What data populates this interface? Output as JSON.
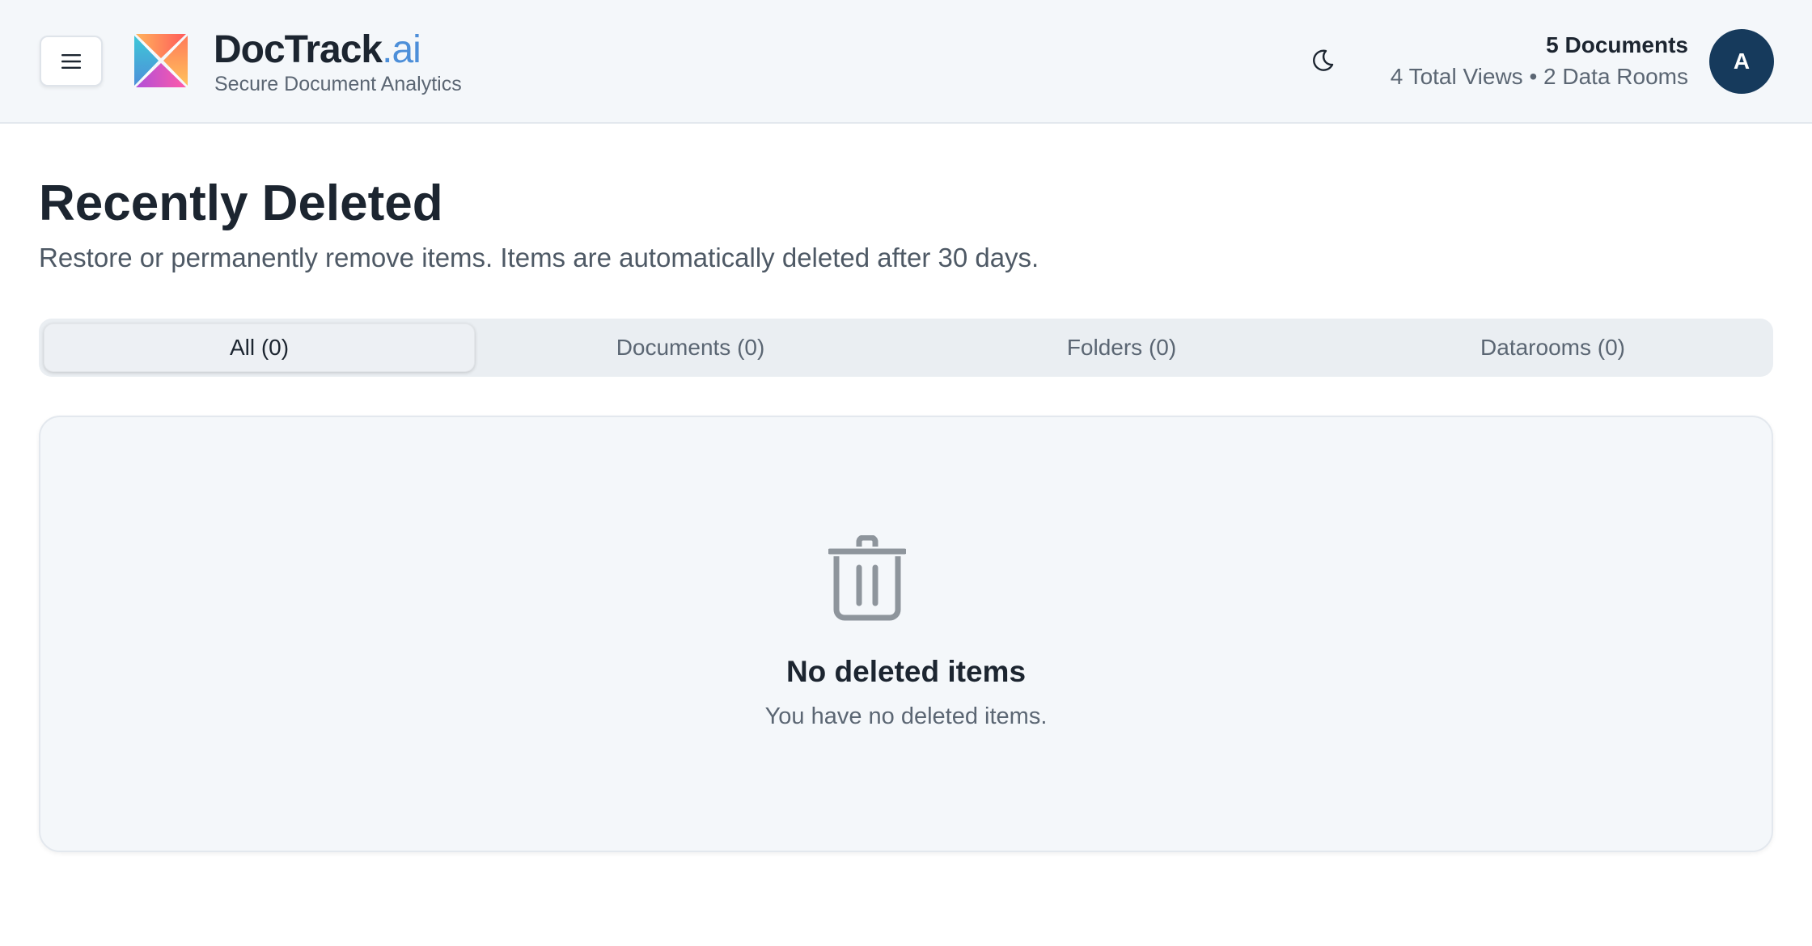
{
  "header": {
    "brand_name": "DocTrack",
    "brand_suffix": ".ai",
    "brand_tagline": "Secure Document Analytics",
    "stats_documents": "5 Documents",
    "stats_detail": "4 Total Views • 2 Data Rooms",
    "avatar_initial": "A",
    "icons": [
      "hamburger-menu-icon",
      "logo",
      "moon-icon"
    ]
  },
  "page": {
    "title": "Recently Deleted",
    "description": "Restore or permanently remove items. Items are automatically deleted after 30 days."
  },
  "tabs": [
    {
      "label": "All (0)",
      "active": true
    },
    {
      "label": "Documents (0)",
      "active": false
    },
    {
      "label": "Folders (0)",
      "active": false
    },
    {
      "label": "Datarooms (0)",
      "active": false
    }
  ],
  "empty_state": {
    "icon": "trash-icon",
    "title": "No deleted items",
    "message": "You have no deleted items."
  },
  "colors": {
    "accent": "#4d8fd9",
    "avatar_bg": "#163a5c",
    "header_bg": "#f4f7fa"
  }
}
